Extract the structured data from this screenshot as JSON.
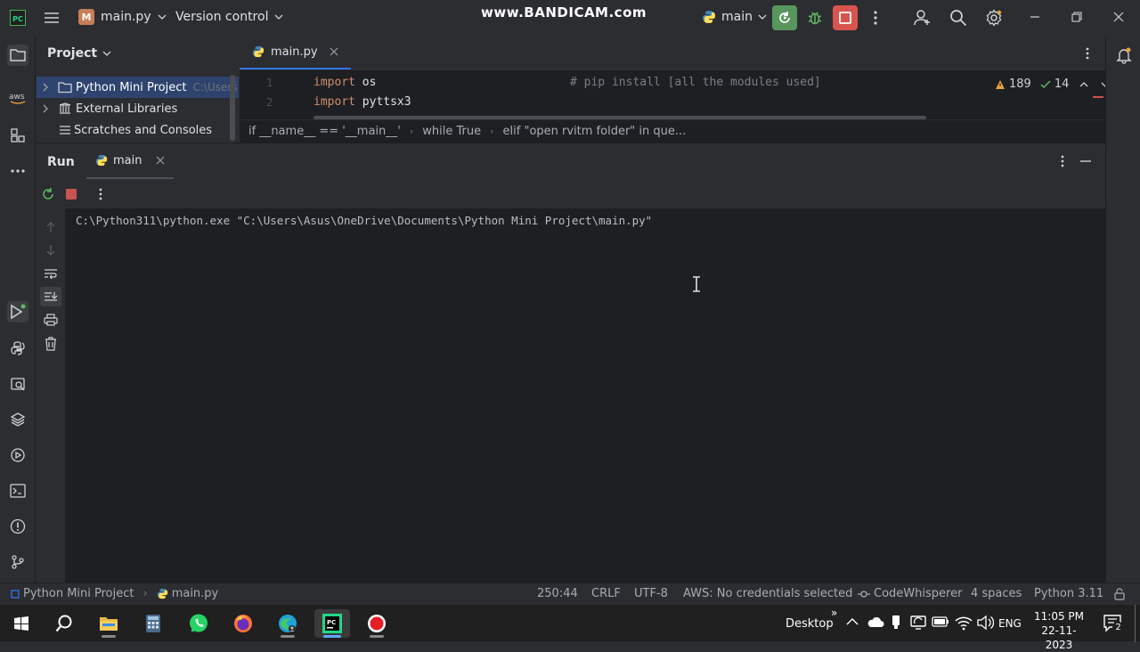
{
  "titlebar": {
    "logo_text": "PC",
    "project_badge": "M",
    "file_name": "main.py",
    "vcs_label": "Version control",
    "watermark": "www.BANDICAM.com",
    "run_config": "main"
  },
  "project_panel": {
    "title": "Project",
    "items": [
      {
        "label": "Python Mini Project",
        "hint": "C:\\Users"
      },
      {
        "label": "External Libraries"
      },
      {
        "label": "Scratches and Consoles"
      }
    ]
  },
  "editor": {
    "tab_label": "main.py",
    "lines": [
      {
        "num": "1",
        "keyword": "import",
        "rest": " os",
        "comment": "# pip install [all the modules used]"
      },
      {
        "num": "2",
        "keyword": "import",
        "rest": " pyttsx3"
      }
    ],
    "warnings": "189",
    "checks": "14",
    "breadcrumbs": [
      "if __name__ == '__main__'",
      "while True",
      "elif \"open rvitm folder\" in que..."
    ]
  },
  "run_window": {
    "title": "Run",
    "tab_label": "main",
    "console_line": "C:\\Python311\\python.exe \"C:\\Users\\Asus\\OneDrive\\Documents\\Python Mini Project\\main.py\""
  },
  "statusbar": {
    "project": "Python Mini Project",
    "file": "main.py",
    "position": "250:44",
    "line_sep": "CRLF",
    "encoding": "UTF-8",
    "aws": "AWS: No credentials selected",
    "codewhisperer": "CodeWhisperer",
    "indent": "4 spaces",
    "interpreter": "Python 3.11"
  },
  "taskbar": {
    "desktop_label": "Desktop",
    "language": "ENG",
    "time": "11:05 PM",
    "date": "22-11-2023",
    "notification_count": "2"
  }
}
